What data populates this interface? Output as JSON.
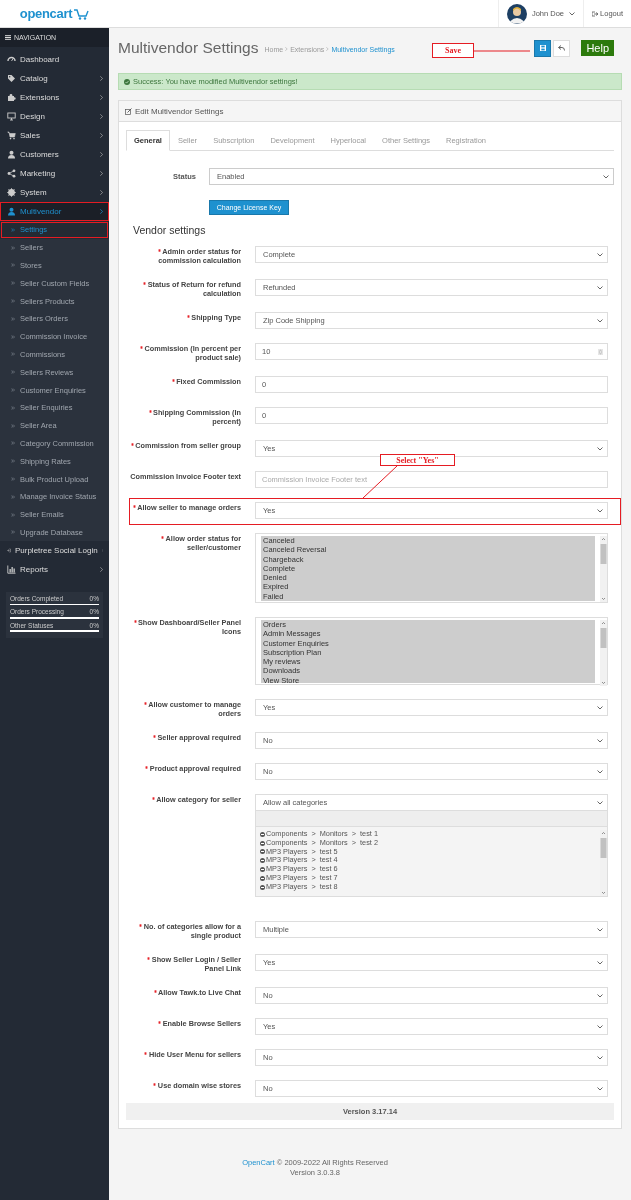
{
  "header": {
    "logo": "opencart",
    "user": "John Doe",
    "logout": "Logout"
  },
  "sidebar": {
    "title": "NAVIGATION",
    "items": [
      {
        "label": "Dashboard",
        "expandable": false,
        "selected": false,
        "highlighted": false
      },
      {
        "label": "Catalog",
        "expandable": true,
        "selected": false,
        "highlighted": false
      },
      {
        "label": "Extensions",
        "expandable": true,
        "selected": false,
        "highlighted": false
      },
      {
        "label": "Design",
        "expandable": true,
        "selected": false,
        "highlighted": false
      },
      {
        "label": "Sales",
        "expandable": true,
        "selected": false,
        "highlighted": false
      },
      {
        "label": "Customers",
        "expandable": true,
        "selected": false,
        "highlighted": false
      },
      {
        "label": "Marketing",
        "expandable": true,
        "selected": false,
        "highlighted": false
      },
      {
        "label": "System",
        "expandable": true,
        "selected": false,
        "highlighted": false
      },
      {
        "label": "Multivendor",
        "expandable": true,
        "selected": true,
        "highlighted": true,
        "children": [
          {
            "label": "Settings",
            "selected": true,
            "highlighted": true
          },
          {
            "label": "Sellers",
            "selected": false,
            "highlighted": false
          },
          {
            "label": "Stores",
            "selected": false,
            "highlighted": false
          },
          {
            "label": "Seller Custom Fields",
            "selected": false,
            "highlighted": false
          },
          {
            "label": "Sellers Products",
            "selected": false,
            "highlighted": false
          },
          {
            "label": "Sellers Orders",
            "selected": false,
            "highlighted": false
          },
          {
            "label": "Commission Invoice",
            "selected": false,
            "highlighted": false
          },
          {
            "label": "Commissions",
            "selected": false,
            "highlighted": false
          },
          {
            "label": "Sellers Reviews",
            "selected": false,
            "highlighted": false
          },
          {
            "label": "Customer Enquiries",
            "selected": false,
            "highlighted": false
          },
          {
            "label": "Seller Enquiries",
            "selected": false,
            "highlighted": false
          },
          {
            "label": "Seller Area",
            "selected": false,
            "highlighted": false
          },
          {
            "label": "Category Commission",
            "selected": false,
            "highlighted": false
          },
          {
            "label": "Shipping Rates",
            "selected": false,
            "highlighted": false
          },
          {
            "label": "Bulk Product Upload",
            "selected": false,
            "highlighted": false
          },
          {
            "label": "Manage Invoice Status",
            "selected": false,
            "highlighted": false
          },
          {
            "label": "Seller Emails",
            "selected": false,
            "highlighted": false
          },
          {
            "label": "Upgrade Database",
            "selected": false,
            "highlighted": false
          }
        ]
      },
      {
        "label": "Purpletree Social Login",
        "expandable": true,
        "selected": false,
        "highlighted": false
      },
      {
        "label": "Reports",
        "expandable": true,
        "selected": false,
        "highlighted": false
      }
    ],
    "stats": [
      {
        "label": "Orders Completed",
        "value": "0%",
        "level": 0
      },
      {
        "label": "Orders Processing",
        "value": "0%",
        "level": 0
      },
      {
        "label": "Other Statuses",
        "value": "0%",
        "level": 0
      }
    ]
  },
  "page": {
    "title": "Multivendor Settings",
    "breadcrumbs": [
      {
        "label": "Home",
        "selected": false
      },
      {
        "label": "Extensions",
        "selected": false
      },
      {
        "label": "Multivendor Settings",
        "selected": true
      }
    ],
    "alert": "Success: You have modified Multivendor settings!",
    "panel_title": "Edit Multivendor Settings",
    "tabs": [
      {
        "label": "General",
        "selected": true
      },
      {
        "label": "Seller",
        "selected": false
      },
      {
        "label": "Subscription",
        "selected": false
      },
      {
        "label": "Development",
        "selected": false
      },
      {
        "label": "Hyperlocal",
        "selected": false
      },
      {
        "label": "Other Settings",
        "selected": false
      },
      {
        "label": "Registration",
        "selected": false
      }
    ],
    "status": {
      "label": "Status",
      "value": "Enabled"
    },
    "license_button": "Change License Key",
    "section_title": "Vendor settings",
    "fields": [
      {
        "kind": "select",
        "label": "Admin order status for commission calculation",
        "required": true,
        "value": "Complete",
        "highlighted": false
      },
      {
        "kind": "select",
        "label": "Status of Return for refund calculation",
        "required": true,
        "value": "Refunded",
        "highlighted": false
      },
      {
        "kind": "select",
        "label": "Shipping Type",
        "required": true,
        "value": "Zip Code Shipping",
        "highlighted": false
      },
      {
        "kind": "number",
        "label": "Commission (In percent per product sale)",
        "required": true,
        "value": "10",
        "highlighted": false
      },
      {
        "kind": "text",
        "label": "Fixed Commission",
        "required": true,
        "value": "0",
        "highlighted": false
      },
      {
        "kind": "text",
        "label": "Shipping Commission (In percent)",
        "required": true,
        "value": "0",
        "highlighted": false
      },
      {
        "kind": "select",
        "label": "Commission from seller group",
        "required": true,
        "value": "Yes",
        "highlighted": false
      },
      {
        "kind": "text",
        "label": "Commission Invoice Footer text",
        "required": false,
        "placeholder": "Commission Invoice Footer text",
        "highlighted": false
      },
      {
        "kind": "select",
        "label": "Allow seller to manage orders",
        "required": true,
        "value": "Yes",
        "highlighted": true
      },
      {
        "kind": "multiselect",
        "label": "Allow order status for seller/customer",
        "required": true,
        "highlighted": false,
        "options": [
          {
            "label": "Canceled",
            "selected": true
          },
          {
            "label": "Canceled Reversal",
            "selected": true
          },
          {
            "label": "Chargeback",
            "selected": true
          },
          {
            "label": "Complete",
            "selected": true
          },
          {
            "label": "Denied",
            "selected": true
          },
          {
            "label": "Expired",
            "selected": true
          },
          {
            "label": "Failed",
            "selected": true
          }
        ]
      },
      {
        "kind": "multiselect",
        "label": "Show Dashboard/Seller Panel Icons",
        "required": true,
        "highlighted": false,
        "options": [
          {
            "label": "Orders",
            "selected": true
          },
          {
            "label": "Admin Messages",
            "selected": true
          },
          {
            "label": "Customer Enquiries",
            "selected": true
          },
          {
            "label": "Subscription Plan",
            "selected": true
          },
          {
            "label": "My reviews",
            "selected": true
          },
          {
            "label": "Downloads",
            "selected": true
          },
          {
            "label": "View Store",
            "selected": true
          }
        ]
      },
      {
        "kind": "select",
        "label": "Allow customer to manage orders",
        "required": true,
        "value": "Yes",
        "highlighted": false
      },
      {
        "kind": "select",
        "label": "Seller approval required",
        "required": true,
        "value": "No",
        "highlighted": false
      },
      {
        "kind": "select",
        "label": "Product approval required",
        "required": true,
        "value": "No",
        "highlighted": false
      },
      {
        "kind": "category",
        "label": "Allow category for seller",
        "required": true,
        "value": "Allow all categories",
        "highlighted": false,
        "items": [
          "Components  >  Monitors  >  test 1",
          "Components  >  Monitors  >  test 2",
          "MP3 Players  >  test 5",
          "MP3 Players  >  test 4",
          "MP3 Players  >  test 6",
          "MP3 Players  >  test 7",
          "MP3 Players  >  test 8"
        ]
      },
      {
        "kind": "select",
        "label": "No. of categories allow for a single product",
        "required": true,
        "value": "Multiple",
        "highlighted": false
      },
      {
        "kind": "select",
        "label": "Show Seller Login / Seller Panel Link",
        "required": true,
        "value": "Yes",
        "highlighted": false
      },
      {
        "kind": "select",
        "label": "Allow Tawk.to Live Chat",
        "required": true,
        "value": "No",
        "highlighted": false
      },
      {
        "kind": "select",
        "label": "Enable Browse Sellers",
        "required": true,
        "value": "Yes",
        "highlighted": false
      },
      {
        "kind": "select",
        "label": "Hide User Menu for sellers",
        "required": true,
        "value": "No",
        "highlighted": false
      },
      {
        "kind": "select",
        "label": "Use domain wise stores",
        "required": true,
        "value": "No",
        "highlighted": false
      }
    ],
    "version": "Version 3.17.14"
  },
  "annotations": {
    "save": "Save",
    "select_hint": "Select \"Yes\"",
    "help": "Help"
  },
  "footer": {
    "link": "OpenCart",
    "text": "© 2009-2022 All Rights Reserved",
    "version": "Version 3.0.3.8"
  }
}
